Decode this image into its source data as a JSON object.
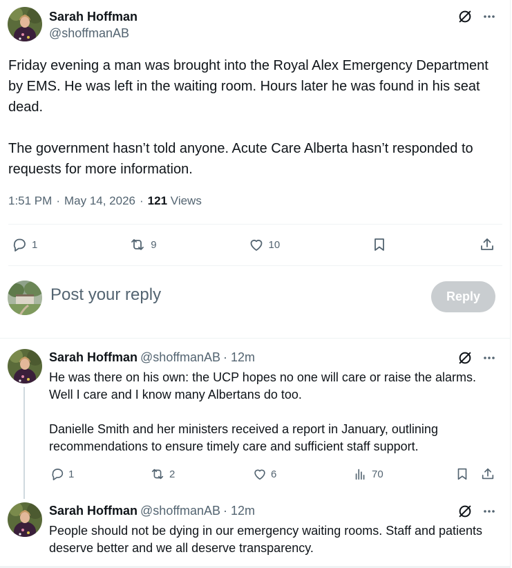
{
  "tweet": {
    "author_name": "Sarah Hoffman",
    "author_handle": "@shoffmanAB",
    "paragraphs": [
      "Friday evening a man was brought into the Royal Alex Emergency Department by EMS. He was left in the waiting room. Hours later he was found in his seat dead.",
      "The government hasn’t told anyone. Acute Care Alberta hasn’t responded to requests for more information."
    ],
    "time": "1:51 PM",
    "date": "May 14, 2026",
    "views_count": "121",
    "views_label": "Views",
    "separator": "·",
    "actions": {
      "replies": "1",
      "reposts": "9",
      "likes": "10"
    },
    "icons": [
      "grok-icon",
      "more-icon",
      "reply-icon",
      "repost-icon",
      "like-icon",
      "bookmark-icon",
      "share-icon"
    ]
  },
  "composer": {
    "placeholder": "Post your reply",
    "reply_button": "Reply"
  },
  "replies": [
    {
      "author_name": "Sarah Hoffman",
      "author_handle": "@shoffmanAB",
      "age": "· 12m",
      "paragraphs": [
        "He was there on his own: the UCP hopes no one will care or raise the alarms. Well I care and I know many Albertans do too.",
        "Danielle Smith and her ministers received a report in January, outlining recommendations to ensure timely care and sufficient staff support."
      ],
      "actions": {
        "replies": "1",
        "reposts": "2",
        "likes": "6",
        "views": "70"
      }
    },
    {
      "author_name": "Sarah Hoffman",
      "author_handle": "@shoffmanAB",
      "age": "· 12m",
      "paragraphs": [
        "People should not be dying in our emergency waiting rooms. Staff and patients deserve better and we all deserve transparency."
      ]
    }
  ],
  "colors": {
    "text": "#0f1419",
    "muted": "#536471",
    "divider": "#eff3f4",
    "reply_button_disabled": "#c9cdd0",
    "thread_line": "#cfd9de"
  }
}
